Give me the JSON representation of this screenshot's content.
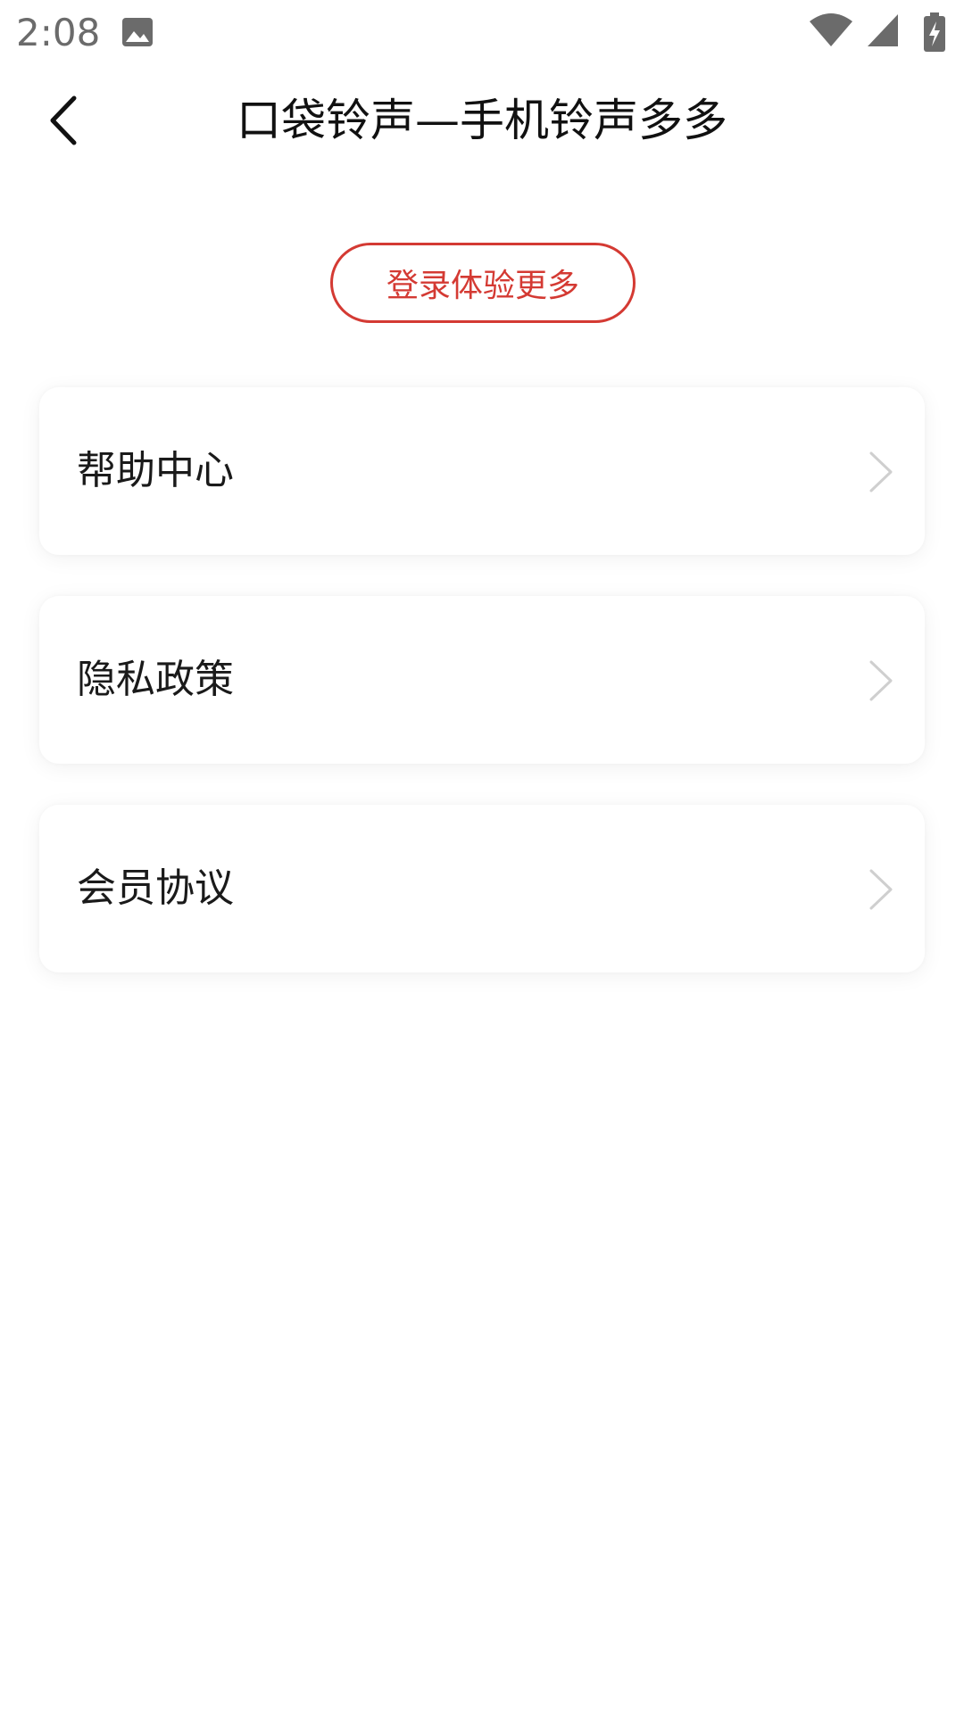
{
  "status_bar": {
    "time": "2:08",
    "icons": [
      "image-icon",
      "wifi-icon",
      "signal-icon",
      "battery-charging-icon"
    ]
  },
  "header": {
    "title": "口袋铃声—手机铃声多多",
    "back_icon": "chevron-left-icon"
  },
  "login_button": {
    "label": "登录体验更多",
    "color": "#d43a33"
  },
  "menu": {
    "items": [
      {
        "label": "帮助中心",
        "icon": "chevron-right-icon"
      },
      {
        "label": "隐私政策",
        "icon": "chevron-right-icon"
      },
      {
        "label": "会员协议",
        "icon": "chevron-right-icon"
      }
    ]
  }
}
